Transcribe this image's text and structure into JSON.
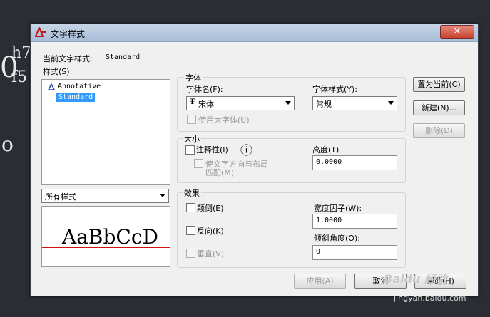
{
  "background": {
    "t1": "0",
    "t2": "h7",
    "t3": "f5",
    "t4": "o"
  },
  "dialog": {
    "title": "文字样式",
    "current_style_label": "当前文字样式:",
    "current_style_value": "Standard",
    "styles_label": "样式(S):",
    "styles": [
      "Annotative",
      "Standard"
    ],
    "filter_value": "所有样式",
    "preview_text": "AaBbCcD",
    "font_group": {
      "title": "字体",
      "font_name_label": "字体名(F):",
      "font_name_value": "宋体",
      "font_style_label": "字体样式(Y):",
      "font_style_value": "常规",
      "bigfont_label": "使用大字体(U)"
    },
    "size_group": {
      "title": "大小",
      "annotative_label": "注释性(I)",
      "info_icon": "ⓘ",
      "match_orientation_line1": "使文字方向与布局",
      "match_orientation_line2": "匹配(M)",
      "height_label": "高度(T)",
      "height_value": "0.0000"
    },
    "effects_group": {
      "title": "效果",
      "upside_down_label": "颠倒(E)",
      "backwards_label": "反向(K)",
      "vertical_label": "垂直(V)",
      "width_factor_label": "宽度因子(W):",
      "width_factor_value": "1.0000",
      "oblique_label": "倾斜角度(O):",
      "oblique_value": "0"
    },
    "buttons": {
      "set_current": "置为当前(C)",
      "new": "新建(N)...",
      "delete": "删除(D)",
      "apply": "应用(A)",
      "cancel": "取消",
      "help": "帮助(H)"
    },
    "close_glyph": "✕"
  },
  "watermark": {
    "brand": "Baidu 经验",
    "url": "jingyan.baidu.com"
  },
  "icons": {
    "title": "autocad-text-icon",
    "annotative": "annotative-triangle-icon",
    "truetype": "truetype-icon",
    "info": "info-icon"
  },
  "colors": {
    "titlebar": "#b5c7de",
    "close": "#c7402b",
    "selection": "#3399ff",
    "baseline": "#d01010"
  }
}
